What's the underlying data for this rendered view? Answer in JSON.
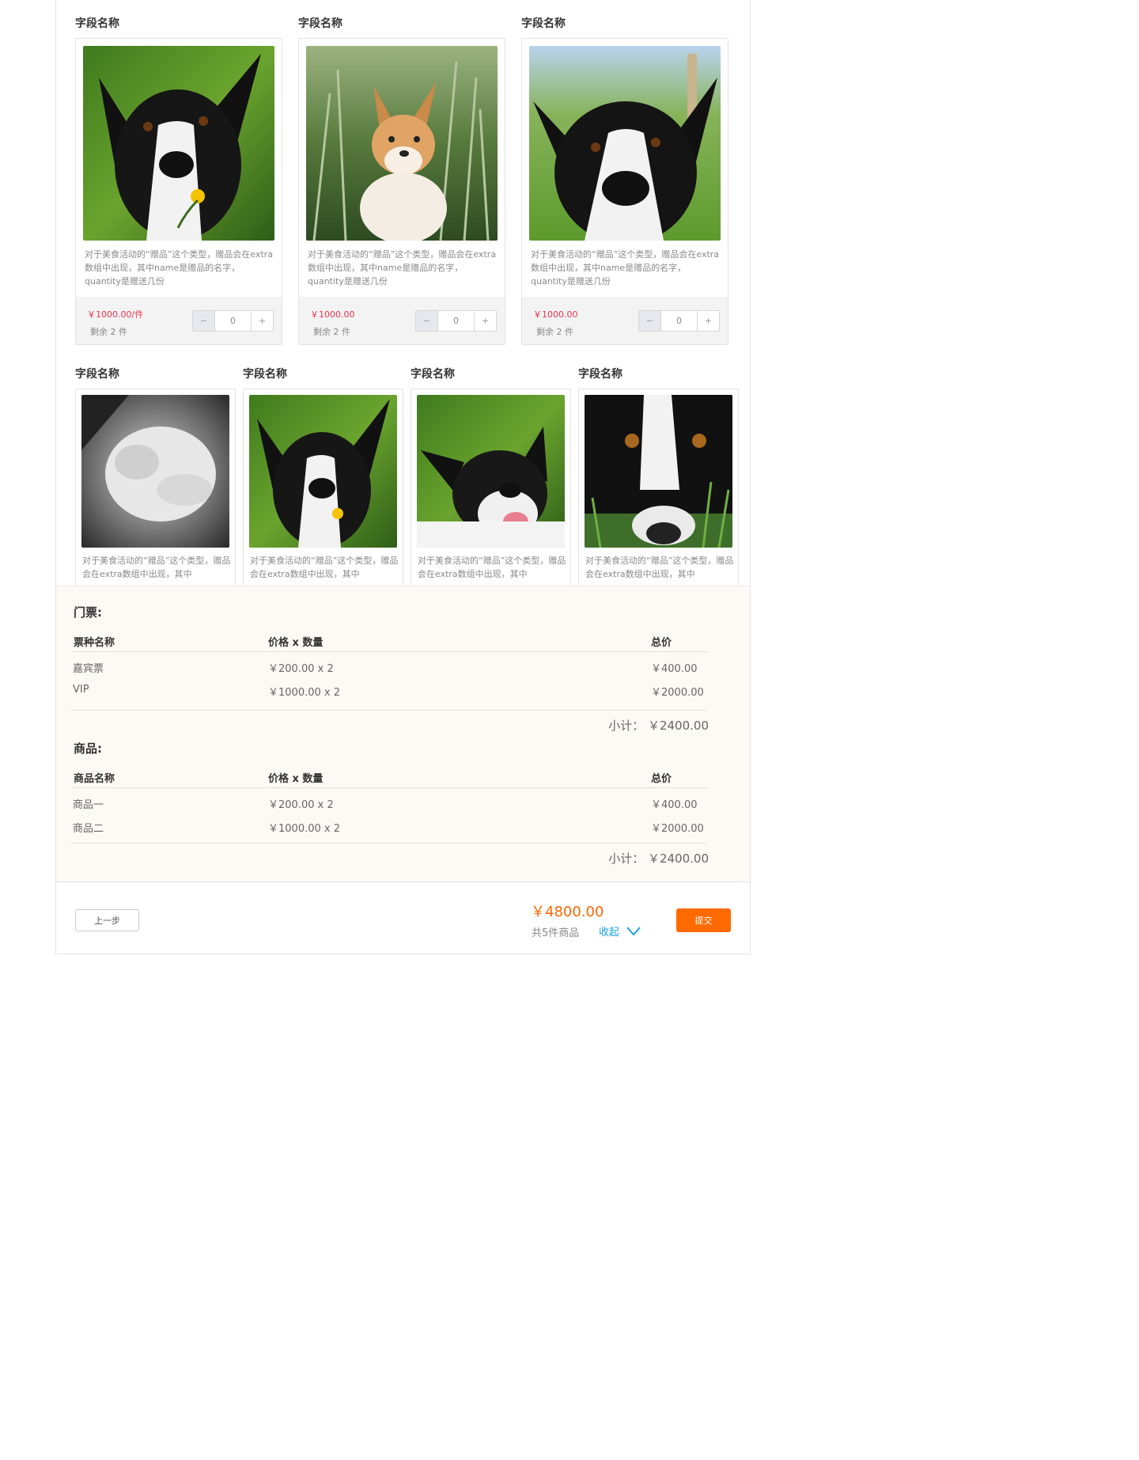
{
  "row1": [
    {
      "field_label": "字段名称",
      "desc": "对于美食活动的“赠品”这个类型，赠品会在extra数组中出现，其中name是赠品的名字，quantity是赠送几份",
      "price": "￥1000.00/件",
      "remain": "剩余 2 件",
      "qty": {
        "minus": "−",
        "value": "0",
        "plus": "+"
      }
    },
    {
      "field_label": "字段名称",
      "desc": "对于美食活动的“赠品”这个类型，赠品会在extra数组中出现，其中name是赠品的名字，quantity是赠送几份",
      "price": "￥1000.00",
      "remain": "剩余 2 件",
      "qty": {
        "minus": "−",
        "value": "0",
        "plus": "+"
      }
    },
    {
      "field_label": "字段名称",
      "desc": "对于美食活动的“赠品”这个类型，赠品会在extra数组中出现，其中name是赠品的名字，quantity是赠送几份",
      "price": "￥1000.00",
      "remain": "剩余 2 件",
      "qty": {
        "minus": "−",
        "value": "0",
        "plus": "+"
      }
    }
  ],
  "row2": [
    {
      "field_label": "字段名称",
      "desc": "对于美食活动的“赠品”这个类型，赠品会在extra数组中出现，其中"
    },
    {
      "field_label": "字段名称",
      "desc": "对于美食活动的“赠品”这个类型，赠品会在extra数组中出现，其中"
    },
    {
      "field_label": "字段名称",
      "desc": "对于美食活动的“赠品”这个类型，赠品会在extra数组中出现，其中"
    },
    {
      "field_label": "字段名称",
      "desc": "对于美食活动的“赠品”这个类型，赠品会在extra数组中出现，其中"
    }
  ],
  "tickets": {
    "title": "门票:",
    "headers": {
      "name": "票种名称",
      "price_qty": "价格 x 数量",
      "total": "总价"
    },
    "rows": [
      {
        "name": "嘉宾票",
        "price_qty": "￥200.00 x 2",
        "total": "￥400.00"
      },
      {
        "name": "VIP",
        "price_qty": "￥1000.00 x 2",
        "total": "￥2000.00"
      }
    ],
    "subtotal": "小计： ￥2400.00"
  },
  "goods": {
    "title": "商品:",
    "headers": {
      "name": "商品名称",
      "price_qty": "价格 x 数量",
      "total": "总价"
    },
    "rows": [
      {
        "name": "商品一",
        "price_qty": "￥200.00 x 2",
        "total": "￥400.00"
      },
      {
        "name": "商品二",
        "price_qty": "￥1000.00 x 2",
        "total": "￥2000.00"
      }
    ],
    "subtotal": "小计： ￥2400.00"
  },
  "footer": {
    "prev_label": "上一步",
    "total": "￥4800.00",
    "count": "共5件商品",
    "collapse_label": "收起",
    "submit_label": "提交"
  },
  "colors": {
    "price_red": "#e8344e",
    "total_orange": "#ff6600",
    "submit_orange": "#ff6a00",
    "link_blue": "#19a4e0",
    "summary_bg": "#fdf9f5"
  }
}
